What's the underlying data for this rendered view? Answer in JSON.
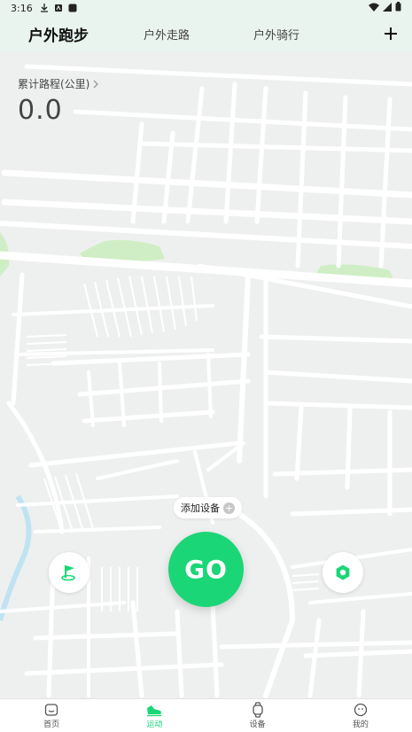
{
  "status_bar": {
    "time": "3:16"
  },
  "tabs": [
    {
      "label": "户外跑步",
      "active": true
    },
    {
      "label": "户外走路",
      "active": false
    },
    {
      "label": "户外骑行",
      "active": false
    }
  ],
  "stats": {
    "label": "累计路程(公里)",
    "value": "0.0"
  },
  "add_device": {
    "label": "添加设备"
  },
  "go_button": {
    "label": "GO"
  },
  "bottom_nav": [
    {
      "label": "首页",
      "icon": "home-icon"
    },
    {
      "label": "运动",
      "icon": "shoe-icon",
      "active": true
    },
    {
      "label": "设备",
      "icon": "watch-icon"
    },
    {
      "label": "我的",
      "icon": "smile-face-icon"
    }
  ],
  "colors": {
    "accent": "#1bd677",
    "map_bg": "#eef0ef",
    "road": "#ffffff",
    "park": "#cfeec5",
    "water": "#bfe3f3"
  }
}
